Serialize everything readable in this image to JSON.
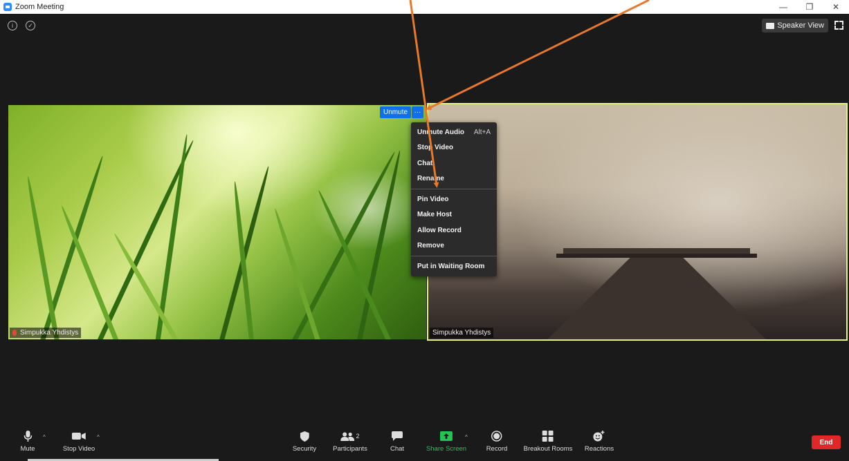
{
  "window": {
    "title": "Zoom Meeting",
    "minimize_glyph": "—",
    "restore_glyph": "❐",
    "close_glyph": "✕"
  },
  "top_bar": {
    "info_icon": "info-icon",
    "shield_icon": "shield-icon",
    "speaker_view_label": "Speaker View",
    "fullscreen_icon": "fullscreen-icon"
  },
  "participants": [
    {
      "name": "Simpukka Yhdistys",
      "muted": true,
      "background": "grass"
    },
    {
      "name": "Simpukka Yhdistys",
      "muted": false,
      "background": "pier",
      "active_speaker": true
    }
  ],
  "hover_controls": {
    "unmute_label": "Unmute",
    "more_label": "···"
  },
  "context_menu": {
    "groups": [
      [
        {
          "label": "Unmute Audio",
          "shortcut": "Alt+A"
        },
        {
          "label": "Stop Video",
          "shortcut": ""
        },
        {
          "label": "Chat",
          "shortcut": ""
        },
        {
          "label": "Rename",
          "shortcut": ""
        }
      ],
      [
        {
          "label": "Pin Video",
          "shortcut": ""
        },
        {
          "label": "Make Host",
          "shortcut": ""
        },
        {
          "label": "Allow Record",
          "shortcut": ""
        },
        {
          "label": "Remove",
          "shortcut": ""
        }
      ],
      [
        {
          "label": "Put in Waiting Room",
          "shortcut": ""
        }
      ]
    ]
  },
  "annotation": {
    "arrow_color": "#e8782a"
  },
  "toolbar": {
    "mute": "Mute",
    "stop_video": "Stop Video",
    "security": "Security",
    "participants": "Participants",
    "participants_count": "2",
    "chat": "Chat",
    "share_screen": "Share Screen",
    "record": "Record",
    "breakout_rooms": "Breakout Rooms",
    "reactions": "Reactions",
    "end": "End",
    "share_color": "#23c552",
    "end_color": "#e02828"
  }
}
